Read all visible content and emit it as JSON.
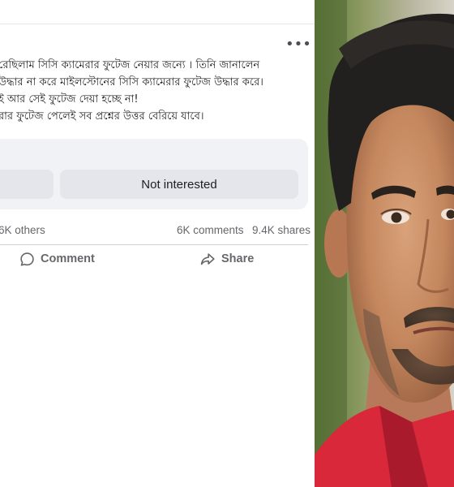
{
  "post": {
    "lines": [
      "রেছিলাম সিসি ক্যামেরার ফুটেজ নেয়ার জন্যে । তিনি জানালেন",
      "উদ্ধার না করে মাইলস্টোনের সিসি ক্যামেরার ফুটেজ উদ্ধার করে।",
      "ই আর সেই ফুটেজ দেয়া হচ্ছে না!",
      "রার ফুটেজ পেলেই সব প্রশ্নের উত্তর বেরিয়ে যাবে।"
    ],
    "more_label": "•••"
  },
  "card": {
    "not_interested_label": "Not interested"
  },
  "stats": {
    "reactions_text": "6K others",
    "comments": "6K comments",
    "shares": "9.4K shares"
  },
  "actions": {
    "comment_label": "Comment",
    "share_label": "Share"
  },
  "colors": {
    "text_primary": "#1c1e21",
    "text_secondary": "#65676b",
    "button_bg": "#e4e6eb",
    "card_bg": "#f0f2f5",
    "photo_shirt_red": "#d8283a"
  }
}
